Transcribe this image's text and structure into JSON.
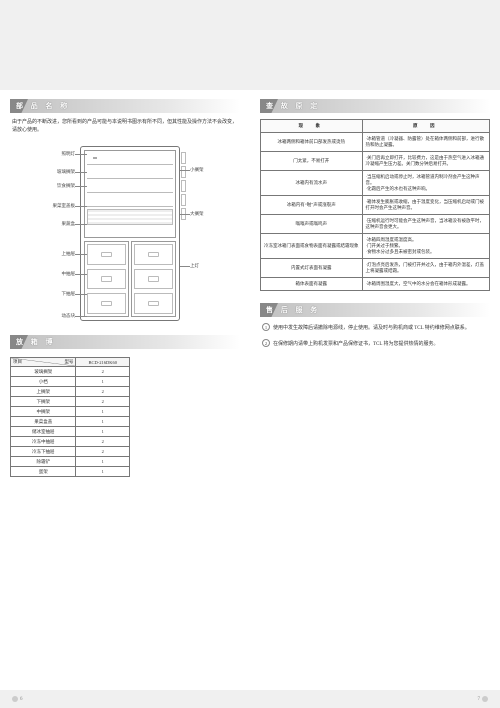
{
  "sections": {
    "parts_title": "部 品 名 称",
    "spec_title": "放 箱 博",
    "phen_title": "查 故 原 定",
    "svc_title": "售 后 服 务"
  },
  "intro": "由于产品的不断改进，您所看到的产品可能与本说明书图示有所不同，但其性能及操作方法不会改变，请放心使用。",
  "callouts": {
    "left": [
      "照明灯",
      "玻璃搁架",
      "饮食搁架",
      "果菜室盖板",
      "果蔬盒",
      "上抽屉",
      "中抽屉",
      "下抽屉",
      "动态块"
    ],
    "right": [
      "小搁架",
      "大搁架",
      "上灯"
    ]
  },
  "spec_table": {
    "head_item": "项目",
    "head_model_label": "型号",
    "head_model": "BCD-216DK60",
    "rows": [
      [
        "玻璃搁架",
        "2"
      ],
      [
        "小档",
        "1"
      ],
      [
        "上搁架",
        "2"
      ],
      [
        "下搁架",
        "2"
      ],
      [
        "中搁架",
        "1"
      ],
      [
        "果菜盒盖",
        "1"
      ],
      [
        "储冰室抽屉",
        "1"
      ],
      [
        "冷冻中抽屉",
        "2"
      ],
      [
        "冷冻下抽屉",
        "2"
      ],
      [
        "除霜铲",
        "1"
      ],
      [
        "蛋架",
        "1"
      ]
    ]
  },
  "phen_table": {
    "head_phen": "现　象",
    "head_cause": "原　因",
    "rows": [
      [
        "冰箱两侧和箱体前口部发热或烫热",
        "·冰箱管道（冷凝器、防露管）处在箱体两侧和前部，进行散热和防止凝露。"
      ],
      [
        "门太紧，不易打开",
        "·关门后再立即打开，比较费力，这是由于热空气进入冰箱通冷凝缩产生压力差。关门数分钟后易打开。"
      ],
      [
        "冰箱内有流水声",
        "·当压缩机启动或停止时，冰箱管道内制冷剂会产生这种声音。\n·化霜后产生的水也有这种声响。"
      ],
      [
        "冰箱内有“啪”声或涨裂声",
        "·箱体发生膨胀或收缩，由于温度变化，当压缩机启动或门被打开时会产生这种声音。"
      ],
      [
        "嗡嗡声或嗡鸣声",
        "·压缩机运行时可能会产生这种声音，当冰箱没有被放平时，这种声音会更大。"
      ],
      [
        "冷冻室冰箱门表面或食物表面有凝露或结霜现象",
        "·冰箱四周湿度或温度高。\n·门开关过于频繁。\n·食物水分过多且未被密封或包装。"
      ],
      [
        "内置式灯表面有凝露",
        "·灯泡点亮后发热，门被打开并过久，由于箱内外温差，灯盖上将凝露或结霜。"
      ],
      [
        "箱体表面有凝露",
        "·冰箱周围湿度大，空气中的水分会在箱体形成凝露。"
      ]
    ]
  },
  "service": {
    "item1": "使用中发生故障后请撤除电源线，停止使用。请及时与购机商或 TCL 特约维修网点联系。",
    "item2": "在保修期内请带上购机发票和产品保修证书，TCL 将为您提供热情的服务。"
  },
  "page_left": "6",
  "page_right": "7"
}
